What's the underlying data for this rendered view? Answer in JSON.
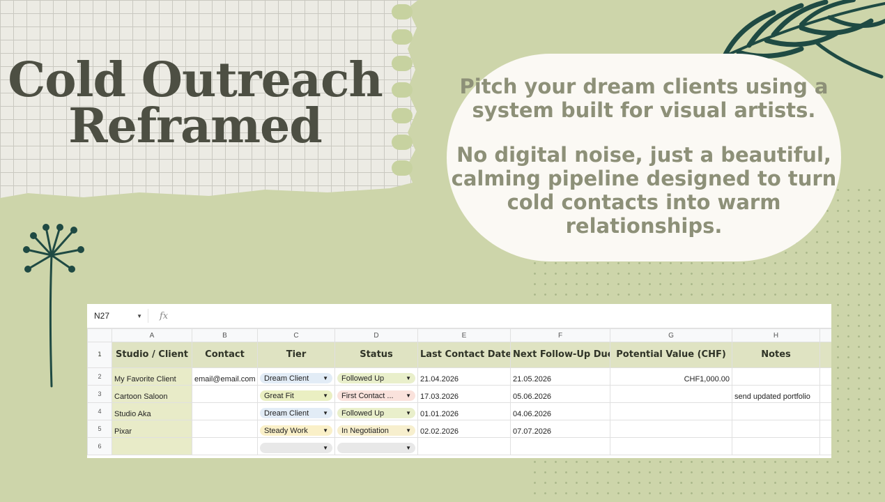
{
  "title": "Cold  Outreach\nReframed",
  "bubble": {
    "line1": "Pitch your dream clients using a system built for visual artists.",
    "line2": "No digital noise, just a beautiful, calming pipeline designed to turn cold contacts into warm relationships."
  },
  "sheet": {
    "name_box": "N27",
    "fx_label": "fx",
    "columns": [
      "A",
      "B",
      "C",
      "D",
      "E",
      "F",
      "G",
      "H"
    ],
    "headers": [
      "Studio / Client",
      "Contact",
      "Tier",
      "Status",
      "Last Contact Date",
      "Next Follow-Up Due",
      "Potential Value (CHF)",
      "Notes"
    ],
    "rows": [
      {
        "num": "2",
        "client": "My Favorite Client",
        "contact": "email@email.com",
        "tier": "Dream Client",
        "tier_color": "#e2ecf6",
        "status": "Followed Up",
        "status_color": "#e9efcb",
        "last": "21.04.2026",
        "next": "21.05.2026",
        "value": "CHF1,000.00",
        "notes": ""
      },
      {
        "num": "3",
        "client": "Cartoon Saloon",
        "contact": "",
        "tier": "Great Fit",
        "tier_color": "#eaefc2",
        "status": "First Contact ...",
        "status_color": "#fae2dc",
        "last": "17.03.2026",
        "next": "05.06.2026",
        "value": "",
        "notes": "send updated portfolio"
      },
      {
        "num": "4",
        "client": "Studio Aka",
        "contact": "",
        "tier": "Dream Client",
        "tier_color": "#e2ecf6",
        "status": "Followed Up",
        "status_color": "#e9efcb",
        "last": "01.01.2026",
        "next": "04.06.2026",
        "value": "",
        "notes": ""
      },
      {
        "num": "5",
        "client": "Pixar",
        "contact": "",
        "tier": "Steady Work",
        "tier_color": "#faf0c8",
        "status": "In Negotiation",
        "status_color": "#f7efce",
        "last": "02.02.2026",
        "next": "07.07.2026",
        "value": "",
        "notes": ""
      },
      {
        "num": "6",
        "client": "",
        "contact": "",
        "tier": "",
        "tier_color": "#e8e8e8",
        "status": "",
        "status_color": "#e8e8e8",
        "last": "",
        "next": "",
        "value": "",
        "notes": ""
      }
    ],
    "header_row_num": "1"
  },
  "colors": {
    "background": "#cdd5aa",
    "accent_text": "#8d9078",
    "title_text": "#4d4f43",
    "leaf": "#1f4a43"
  }
}
